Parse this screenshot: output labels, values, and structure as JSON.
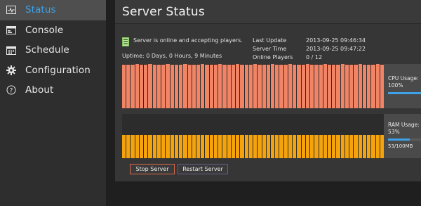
{
  "sidebar": {
    "items": [
      {
        "label": "Status",
        "icon": "activity-monitor-icon",
        "active": true
      },
      {
        "label": "Console",
        "icon": "console-window-icon",
        "active": false
      },
      {
        "label": "Schedule",
        "icon": "calendar-icon",
        "active": false
      },
      {
        "label": "Configuration",
        "icon": "gear-icon",
        "active": false
      },
      {
        "label": "About",
        "icon": "question-circle-icon",
        "active": false
      }
    ]
  },
  "page": {
    "title": "Server Status"
  },
  "status": {
    "message": "Server is online and accepting players.",
    "uptime": "Uptime: 0 Days, 0 Hours, 9 Minutes"
  },
  "meta": {
    "last_update_label": "Last Update",
    "last_update_value": "2013-09-25 09:46:34",
    "server_time_label": "Server Time",
    "server_time_value": "2013-09-25 09:47:22",
    "online_players_label": "Online Players",
    "online_players_value": "0 / 12"
  },
  "cpu": {
    "label": "CPU Usage:",
    "value": "100%",
    "fraction": 1.0,
    "history": [
      0.98,
      0.99,
      0.98,
      1.0,
      0.99,
      0.98,
      1.0,
      0.99,
      0.98,
      0.99,
      1.0,
      0.98,
      0.99,
      0.98,
      1.0,
      0.99,
      0.98,
      0.99,
      1.0,
      0.98,
      0.99,
      0.98,
      1.0,
      0.99,
      0.98,
      0.99,
      1.0,
      0.98,
      0.99,
      0.98,
      1.0,
      0.99,
      0.98,
      0.99,
      1.0,
      0.98,
      0.99,
      0.98,
      1.0,
      0.99,
      0.98,
      0.99,
      1.0,
      0.98,
      0.99,
      0.98,
      1.0,
      0.99,
      0.98,
      0.99,
      1.0,
      0.98,
      0.99,
      0.98,
      1.0,
      0.99,
      0.98,
      0.99,
      1.0,
      0.98
    ]
  },
  "ram": {
    "label": "RAM Usage:",
    "value": "53%",
    "fraction": 0.53,
    "detail": "53/100MB",
    "history": [
      0.53,
      0.53,
      0.53,
      0.53,
      0.53,
      0.53,
      0.53,
      0.53,
      0.53,
      0.53,
      0.53,
      0.53,
      0.53,
      0.53,
      0.53,
      0.53,
      0.53,
      0.53,
      0.53,
      0.53,
      0.53,
      0.53,
      0.53,
      0.53,
      0.53,
      0.53,
      0.53,
      0.53,
      0.53,
      0.53,
      0.53,
      0.53,
      0.53,
      0.53,
      0.53,
      0.53,
      0.53,
      0.53,
      0.53,
      0.53,
      0.53,
      0.53,
      0.53,
      0.53,
      0.53,
      0.53,
      0.53,
      0.53,
      0.53,
      0.53,
      0.53,
      0.53,
      0.53,
      0.53,
      0.53,
      0.53,
      0.53,
      0.53,
      0.53,
      0.53
    ]
  },
  "buttons": {
    "stop": "Stop Server",
    "restart": "Restart Server"
  },
  "colors": {
    "accent": "#3fa2e8",
    "cpu": "#f28466",
    "ram": "#f4a30c"
  }
}
